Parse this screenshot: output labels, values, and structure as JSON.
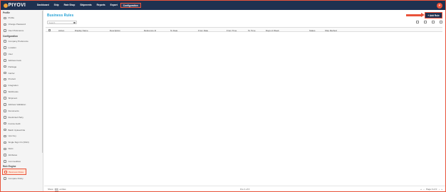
{
  "header": {
    "logo": "PIYOVI",
    "nav": [
      "Dashboard",
      "Ship",
      "Rate Shop",
      "Shipments",
      "Reports",
      "Export",
      "Configuration"
    ],
    "active_nav": "Configuration",
    "user_initial": "P"
  },
  "sidebar": {
    "profile_title": "Profile",
    "profile_items": [
      "Profile",
      "Change Password",
      "User Preference"
    ],
    "config_title": "Configuration",
    "config_items": [
      "Company Preference",
      "Location",
      "User",
      "Address book",
      "Package",
      "Carrier",
      "Product",
      "Integration",
      "Webhooks",
      "Shipment",
      "Address Validation",
      "Documents",
      "Restricted Party",
      "Invoice Audit",
      "Batch Upload File",
      "Ups Key",
      "Single Sign On (SSO)",
      "ISCC",
      "Attributes",
      "Commodities"
    ],
    "rule_title": "Rule Engine",
    "rule_items": [
      "Business Rules",
      "Compare Policy"
    ],
    "active_item": "Business Rules"
  },
  "main": {
    "title": "Business Rules",
    "add_button": "+ Add Rule",
    "search_placeholder": "Search",
    "columns": [
      "Action",
      "Display Name",
      "Description",
      "Reference Id",
      "To Date",
      "From Date",
      "From Time",
      "To Time",
      "Days of Week",
      "Status",
      "Ship Method"
    ],
    "rows": []
  },
  "footer": {
    "show_label": "Show",
    "page_size": "100",
    "entries_label": "entries",
    "count_text": "0 to 1 of 0",
    "page_text": "Page 0 of 0"
  }
}
